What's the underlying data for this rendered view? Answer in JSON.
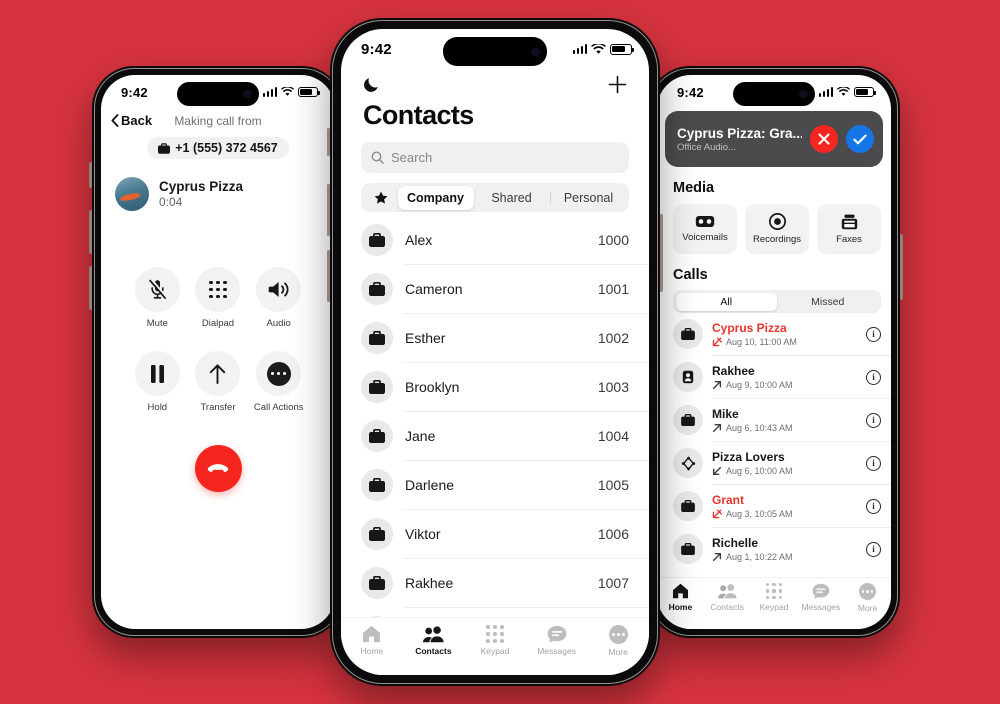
{
  "background_color": "#d6333e",
  "accent_red": "#e5362e",
  "accent_blue": "#1576e8",
  "left_phone": {
    "status": {
      "time": "9:42",
      "signal_icon": "cellular-bars-icon",
      "wifi_icon": "wifi-icon",
      "battery_icon": "battery-icon"
    },
    "back_label": "Back",
    "header_title": "Making call from",
    "caller_id_number": "+1 (555) 372 4567",
    "caller_id_icon": "briefcase-icon",
    "callee": {
      "name": "Cyprus Pizza",
      "duration": "0:04",
      "avatar": "contact-photo"
    },
    "controls": [
      {
        "label": "Mute",
        "icon": "microphone-muted-icon"
      },
      {
        "label": "Dialpad",
        "icon": "dialpad-icon"
      },
      {
        "label": "Audio",
        "icon": "speaker-icon"
      },
      {
        "label": "Hold",
        "icon": "pause-icon"
      },
      {
        "label": "Transfer",
        "icon": "arrow-up-icon"
      },
      {
        "label": "Call Actions",
        "icon": "ellipsis-icon"
      }
    ],
    "end_call_icon": "end-call-handset-icon"
  },
  "center_phone": {
    "status": {
      "time": "9:42",
      "signal_icon": "cellular-bars-icon",
      "wifi_icon": "wifi-icon",
      "battery_icon": "battery-icon"
    },
    "moon_icon": "moon-dnd-icon",
    "add_icon": "plus-icon",
    "title": "Contacts",
    "search_placeholder": "Search",
    "search_icon": "search-icon",
    "segments": {
      "star_icon": "star-icon",
      "items": [
        "Company",
        "Shared",
        "Personal"
      ],
      "active": "Company"
    },
    "contacts": [
      {
        "name": "Alex",
        "ext": "1000",
        "icon": "briefcase-icon"
      },
      {
        "name": "Cameron",
        "ext": "1001",
        "icon": "briefcase-icon"
      },
      {
        "name": "Esther",
        "ext": "1002",
        "icon": "briefcase-icon"
      },
      {
        "name": "Brooklyn",
        "ext": "1003",
        "icon": "briefcase-icon"
      },
      {
        "name": "Jane",
        "ext": "1004",
        "icon": "briefcase-icon"
      },
      {
        "name": "Darlene",
        "ext": "1005",
        "icon": "briefcase-icon"
      },
      {
        "name": "Viktor",
        "ext": "1006",
        "icon": "briefcase-icon"
      },
      {
        "name": "Rakhee",
        "ext": "1007",
        "icon": "briefcase-icon"
      }
    ],
    "tabs": [
      {
        "label": "Home",
        "icon": "home-icon",
        "active": false
      },
      {
        "label": "Contacts",
        "icon": "contacts-icon",
        "active": true
      },
      {
        "label": "Keypad",
        "icon": "keypad-icon",
        "active": false
      },
      {
        "label": "Messages",
        "icon": "messages-icon",
        "active": false
      },
      {
        "label": "More",
        "icon": "more-icon",
        "active": false
      }
    ]
  },
  "right_phone": {
    "status": {
      "time": "9:42",
      "signal_icon": "cellular-bars-icon",
      "wifi_icon": "wifi-icon",
      "battery_icon": "battery-icon"
    },
    "incoming_call": {
      "title": "Cyprus Pizza: Gra...",
      "subtitle": "Office Audio...",
      "decline_icon": "x-icon",
      "accept_icon": "check-icon"
    },
    "media_section_title": "Media",
    "media": [
      {
        "label": "Voicemails",
        "icon": "voicemail-icon"
      },
      {
        "label": "Recordings",
        "icon": "record-icon"
      },
      {
        "label": "Faxes",
        "icon": "fax-icon"
      }
    ],
    "calls_section_title": "Calls",
    "calls_filter": {
      "items": [
        "All",
        "Missed"
      ],
      "active": "All"
    },
    "calls": [
      {
        "name": "Cyprus Pizza",
        "meta": "Aug 10, 11:00 AM",
        "direction": "missed",
        "avatar_icon": "briefcase-icon",
        "missed": true
      },
      {
        "name": "Rakhee",
        "meta": "Aug 9, 10:00 AM",
        "direction": "outgoing",
        "avatar_icon": "person-card-icon",
        "missed": false
      },
      {
        "name": "Mike",
        "meta": "Aug 6, 10:43 AM",
        "direction": "outgoing",
        "avatar_icon": "briefcase-icon",
        "missed": false
      },
      {
        "name": "Pizza Lovers",
        "meta": "Aug 6, 10:00 AM",
        "direction": "incoming",
        "avatar_icon": "group-node-icon",
        "missed": false
      },
      {
        "name": "Grant",
        "meta": "Aug 3, 10:05 AM",
        "direction": "missed",
        "avatar_icon": "briefcase-icon",
        "missed": true
      },
      {
        "name": "Richelle",
        "meta": "Aug 1, 10:22 AM",
        "direction": "outgoing",
        "avatar_icon": "briefcase-icon",
        "missed": false
      }
    ],
    "tabs": [
      {
        "label": "Home",
        "icon": "home-icon",
        "active": true
      },
      {
        "label": "Contacts",
        "icon": "contacts-icon",
        "active": false
      },
      {
        "label": "Keypad",
        "icon": "keypad-icon",
        "active": false
      },
      {
        "label": "Messages",
        "icon": "messages-icon",
        "active": false
      },
      {
        "label": "More",
        "icon": "more-icon",
        "active": false
      }
    ]
  }
}
